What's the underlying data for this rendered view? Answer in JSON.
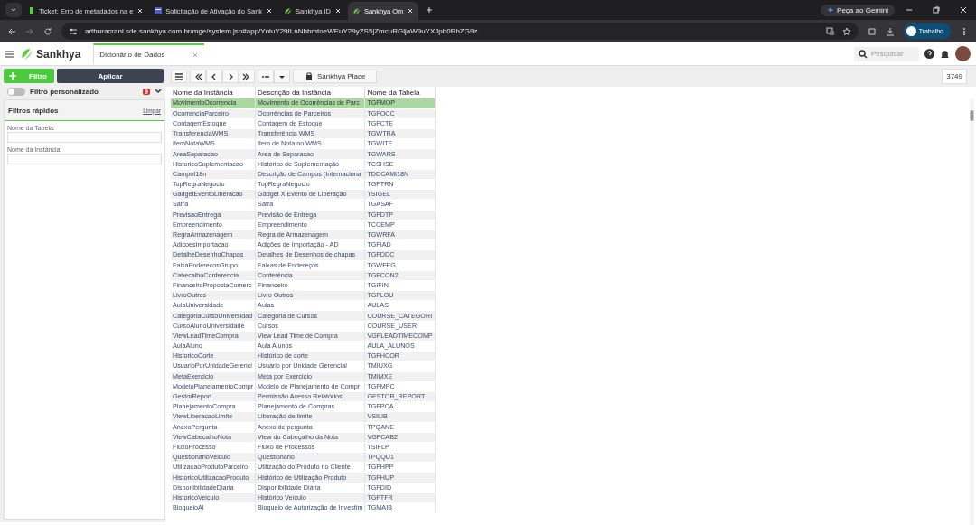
{
  "browser": {
    "tabs": [
      {
        "title": "Ticket: Erro de metadados na e",
        "selected": false
      },
      {
        "title": "Solicitação de Ativação do Sank",
        "selected": false
      },
      {
        "title": "Sankhya ID",
        "selected": false
      },
      {
        "title": "Sankhya Om",
        "selected": true
      }
    ],
    "gemini": "Peça ao Gemini",
    "url": "arthuracrani.sde.sankhya.com.br/mge/system.jsp#app/YnluY29tLnNhbmtoeWEuY29yZS5jZmcuRGljaW9uYXJpb0RhZG9z",
    "profile": "Trabalho"
  },
  "app": {
    "logo": "Sankhya",
    "tab": "Dicionário de Dados",
    "search": {
      "placeholder": "Pesquisar"
    }
  },
  "filters": {
    "add": "Filtro",
    "apply": "Aplicar",
    "custom": {
      "label": "Filtro personalizado",
      "on": false,
      "count": "9"
    },
    "quick": {
      "title": "Filtros rápidos",
      "clear": "Limpar",
      "fields": [
        {
          "label": "Nome da Tabela:"
        },
        {
          "label": "Nome da Instância:"
        }
      ]
    }
  },
  "toolbar": {
    "place": "Sankhya Place",
    "total": "3749"
  },
  "table": {
    "columns": [
      "Nome da Instância",
      "Descrição da Instância",
      "Nome da Tabela"
    ],
    "rows": [
      {
        "cells": [
          "MovimentoOcorrencia",
          "Movimento de Ocorrências de Parc",
          "TGFMOP"
        ],
        "selected": true
      },
      {
        "cells": [
          "OcorrenciaParceiro",
          "Ocorrências de Parceiros",
          "TGFOCC"
        ],
        "selected": false
      },
      {
        "cells": [
          "ContagemEstoque",
          "Contagem de Estoque",
          "TGFCTE"
        ],
        "selected": false
      },
      {
        "cells": [
          "TransferenciaWMS",
          "Transferência WMS",
          "TGWTRA"
        ],
        "selected": false
      },
      {
        "cells": [
          "ItemNotaWMS",
          "Item de Nota no WMS",
          "TGWITE"
        ],
        "selected": false
      },
      {
        "cells": [
          "AreaSeparacao",
          "Area de Separacao",
          "TGWARS"
        ],
        "selected": false
      },
      {
        "cells": [
          "HistoricoSuplementacao",
          "Histórico de Suplementação",
          "TCSHSE"
        ],
        "selected": false
      },
      {
        "cells": [
          "CampoI18n",
          "Descrição de Campos (Internaciona",
          "TDDCAMI18N"
        ],
        "selected": false
      },
      {
        "cells": [
          "TopRegraNegocio",
          "TopRegraNegocio",
          "TGFTRN"
        ],
        "selected": false
      },
      {
        "cells": [
          "GadgetEventoLiberacao",
          "Gadget X Evento de Liberação",
          "TSIGEL"
        ],
        "selected": false
      },
      {
        "cells": [
          "Safra",
          "Safra",
          "TGASAF"
        ],
        "selected": false
      },
      {
        "cells": [
          "PrevisaoEntrega",
          "Previsão de Entrega",
          "TGFDTP"
        ],
        "selected": false
      },
      {
        "cells": [
          "Empreendimento",
          "Empreendimento",
          "TCCEMP"
        ],
        "selected": false
      },
      {
        "cells": [
          "RegraArmazenagem",
          "Regra de Armazenagem",
          "TGWRFA"
        ],
        "selected": false
      },
      {
        "cells": [
          "AdicoesImportacao",
          "Adições de Importação - AD",
          "TGFIAD"
        ],
        "selected": false
      },
      {
        "cells": [
          "DetalheDesenhoChapas",
          "Detalhes de Desenhos de chapas",
          "TGFDDC"
        ],
        "selected": false
      },
      {
        "cells": [
          "FaixaEnderecosGrupo",
          "Faixas de Endereços",
          "TGWFEG"
        ],
        "selected": false
      },
      {
        "cells": [
          "CabecalhoConferencia",
          "Conferência",
          "TGFCON2"
        ],
        "selected": false
      },
      {
        "cells": [
          "FinanceiroPropostaComerc",
          "Financeiro",
          "TGIFIN"
        ],
        "selected": false
      },
      {
        "cells": [
          "LivroOutros",
          "Livro Outros",
          "TGFLOU"
        ],
        "selected": false
      },
      {
        "cells": [
          "AulaUniversidade",
          "Aulas",
          "AULAS"
        ],
        "selected": false
      },
      {
        "cells": [
          "CategoriaCursoUniversidad",
          "Categoria de Cursos",
          "COURSE_CATEGORI"
        ],
        "selected": false
      },
      {
        "cells": [
          "CursoAlunoUniversidade",
          "Cursos",
          "COURSE_USER"
        ],
        "selected": false
      },
      {
        "cells": [
          "ViewLeadTimeCompra",
          "View Lead Time de Compra",
          "VGFLEADTIMECOMP"
        ],
        "selected": false
      },
      {
        "cells": [
          "AulaAluno",
          "Aula Alunos",
          "AULA_ALUNOS"
        ],
        "selected": false
      },
      {
        "cells": [
          "HistoricoCorte",
          "Histórico de corte",
          "TGFHCOR"
        ],
        "selected": false
      },
      {
        "cells": [
          "UsuarioPorUnidadeGerenci",
          "Usuário por Unidade Gerencial",
          "TMIUXG"
        ],
        "selected": false
      },
      {
        "cells": [
          "MetaExercicio",
          "Meta por Exercício",
          "TMIMXE"
        ],
        "selected": false
      },
      {
        "cells": [
          "ModeloPlanejamentoCompr",
          "Modelo de Planejamento de Compr",
          "TGFMPC"
        ],
        "selected": false
      },
      {
        "cells": [
          "GestorReport",
          "Permissão Acesso Relatórios",
          "GESTOR_REPORT"
        ],
        "selected": false
      },
      {
        "cells": [
          "PlanejamentoCompra",
          "Planejamento de Compras",
          "TGFPCA"
        ],
        "selected": false
      },
      {
        "cells": [
          "ViewLiberacaoLimite",
          "Liberação de limite",
          "VSILIB"
        ],
        "selected": false
      },
      {
        "cells": [
          "AnexoPergunta",
          "Anexo de pergunta",
          "TPQANE"
        ],
        "selected": false
      },
      {
        "cells": [
          "ViewCabecalhoNota",
          "View do Cabeçalho da Nota",
          "VGFCAB2"
        ],
        "selected": false
      },
      {
        "cells": [
          "FluxoProcesso",
          "Fluxo de Processos",
          "TSIFLP"
        ],
        "selected": false
      },
      {
        "cells": [
          "QuestionarioVeiculo",
          "Questionário",
          "TPQQU1"
        ],
        "selected": false
      },
      {
        "cells": [
          "UtilizacaoProdutoParceiro",
          "Utilização do Produto no Cliente",
          "TGFHPP"
        ],
        "selected": false
      },
      {
        "cells": [
          "HistoricoUtilizacaoProduto",
          "Histórico de Utilização Produto",
          "TGFHUP"
        ],
        "selected": false
      },
      {
        "cells": [
          "DisponibilidadeDiaria",
          "Disponibilidade Diária",
          "TGFDID"
        ],
        "selected": false
      },
      {
        "cells": [
          "HistoricoVeiculo",
          "Histórico Veículo",
          "TGFTFR"
        ],
        "selected": false
      },
      {
        "cells": [
          "BloqueioAI",
          "Bloqueio de Autorização de Investim",
          "TGMAIB"
        ],
        "selected": false
      }
    ]
  }
}
